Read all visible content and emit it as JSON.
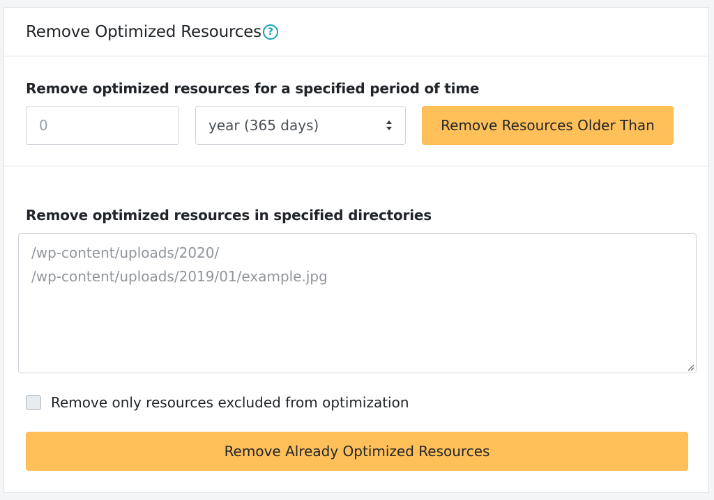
{
  "header": {
    "title": "Remove Optimized Resources",
    "help_glyph": "?"
  },
  "period": {
    "label": "Remove optimized resources for a specified period of time",
    "number_placeholder": "0",
    "unit_selected": "year (365 days)",
    "button_label": "Remove Resources Older Than"
  },
  "directories": {
    "label": "Remove optimized resources in specified directories",
    "placeholder_lines": [
      "/wp-content/uploads/2020/",
      "/wp-content/uploads/2019/01/example.jpg"
    ]
  },
  "excluded_only": {
    "label": "Remove only resources excluded from optimization",
    "checked": false
  },
  "remove_button": {
    "label": "Remove Already Optimized Resources"
  },
  "colors": {
    "accent_button": "#ffc05a",
    "help_icon": "#17a2b8"
  },
  "icons": {
    "help": "question-circle-icon",
    "select": "sort-arrows-icon",
    "resize": "resize-grip-icon"
  }
}
